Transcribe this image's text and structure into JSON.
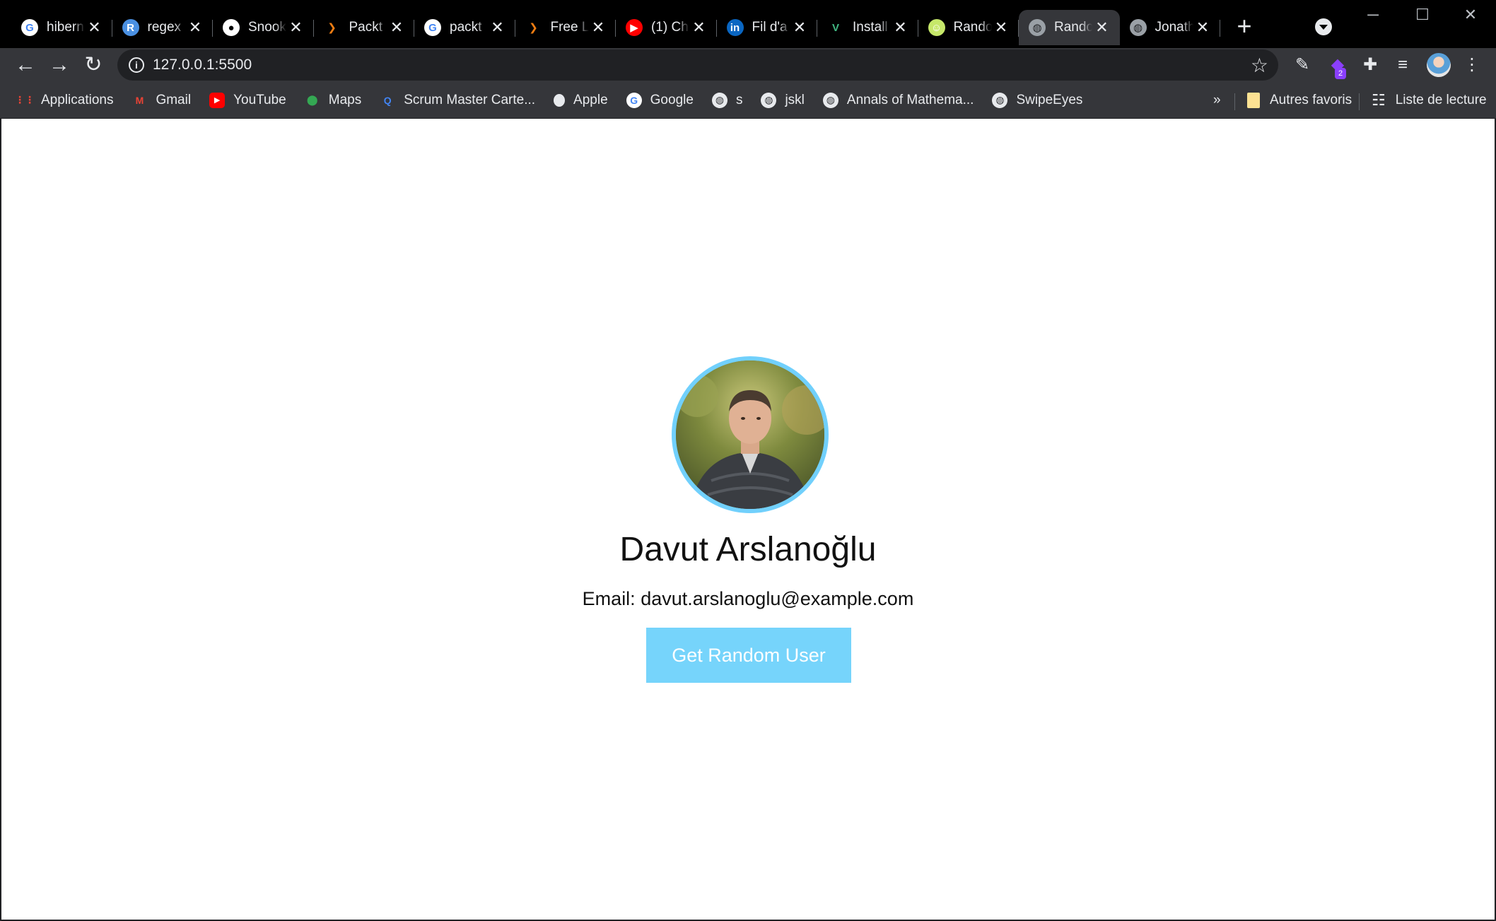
{
  "browser": {
    "tabs": [
      {
        "title": "hibern",
        "favicon": "google-icon",
        "color": "#ffffff"
      },
      {
        "title": "regex",
        "favicon": "r-icon",
        "color": "#4a90e2"
      },
      {
        "title": "Snook",
        "favicon": "github-icon",
        "color": "#ffffff"
      },
      {
        "title": "Packt",
        "favicon": "packt-icon",
        "color": "#f07d12"
      },
      {
        "title": "packt",
        "favicon": "google-icon",
        "color": "#ffffff"
      },
      {
        "title": "Free L",
        "favicon": "packt-icon",
        "color": "#f07d12"
      },
      {
        "title": "(1) Ch",
        "favicon": "youtube-icon",
        "color": "#ff0000"
      },
      {
        "title": "Fil d'a",
        "favicon": "linkedin-icon",
        "color": "#0a66c2"
      },
      {
        "title": "Install",
        "favicon": "vue-icon",
        "color": "#41b883"
      },
      {
        "title": "Rando",
        "favicon": "smile-icon",
        "color": "#c6e86a"
      },
      {
        "title": "Rando",
        "favicon": "globe-icon",
        "color": "#9aa0a6",
        "active": true
      },
      {
        "title": "Jonath",
        "favicon": "globe-icon",
        "color": "#9aa0a6"
      }
    ],
    "close_glyph": "✕",
    "new_tab_glyph": "+",
    "url": "127.0.0.1:5500",
    "bookmarks": [
      {
        "label": "Applications",
        "icon": "apps-grid-icon",
        "color": "#ea4335"
      },
      {
        "label": "Gmail",
        "icon": "gmail-icon",
        "color": "#ea4335"
      },
      {
        "label": "YouTube",
        "icon": "youtube-icon",
        "color": "#ff0000"
      },
      {
        "label": "Maps",
        "icon": "maps-pin-icon",
        "color": "#34a853"
      },
      {
        "label": "Scrum Master Carte...",
        "icon": "q-icon",
        "color": "#4285f4"
      },
      {
        "label": "Apple",
        "icon": "apple-icon",
        "color": "#e8eaed"
      },
      {
        "label": "Google",
        "icon": "google-icon",
        "color": "#ffffff"
      },
      {
        "label": "s",
        "icon": "globe-icon",
        "color": "#e8eaed"
      },
      {
        "label": "jskl",
        "icon": "globe-icon",
        "color": "#e8eaed"
      },
      {
        "label": "Annals of Mathema...",
        "icon": "globe-icon",
        "color": "#e8eaed"
      },
      {
        "label": "SwipeEyes",
        "icon": "globe-icon",
        "color": "#e8eaed"
      }
    ],
    "bookmarks_overflow": "»",
    "other_bookmarks": "Autres favoris",
    "reading_list": "Liste de lecture",
    "extension_badge": "2"
  },
  "page": {
    "user_name": "Davut Arslanoğlu",
    "email_label": "Email:",
    "email": "davut.arslanoglu@example.com",
    "button_label": "Get Random User",
    "accent_color": "#71d0fc"
  }
}
